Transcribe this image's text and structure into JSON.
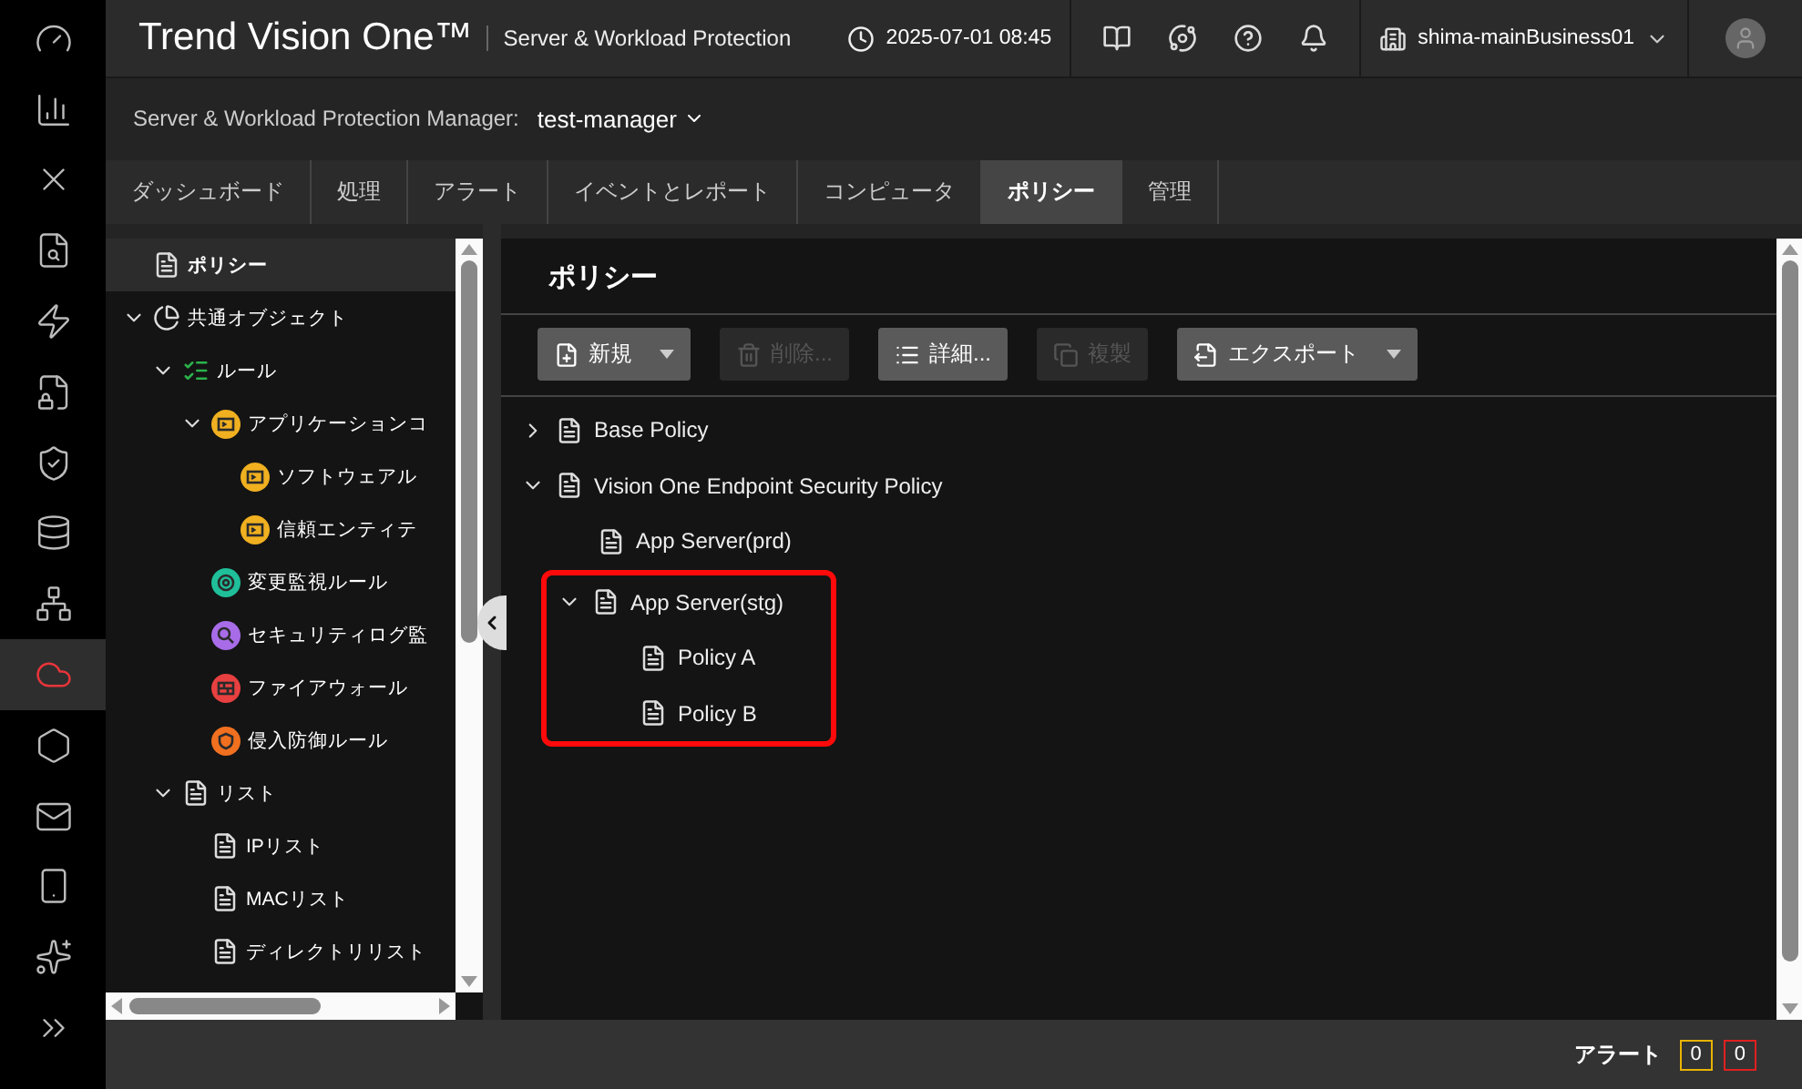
{
  "nav_items": [
    {
      "selected": false
    },
    {
      "selected": false
    },
    {
      "selected": false
    },
    {
      "selected": false
    },
    {
      "selected": false
    },
    {
      "selected": false
    },
    {
      "selected": false
    },
    {
      "selected": false
    },
    {
      "selected": false
    },
    {
      "selected": true
    },
    {
      "selected": false
    },
    {
      "selected": false
    },
    {
      "selected": false
    },
    {
      "selected": false
    },
    {
      "selected": false
    }
  ],
  "header": {
    "brand": "Trend Vision One™",
    "product": "Server & Workload Protection",
    "datetime": "2025-07-01 08:45",
    "account": "shima-mainBusiness01"
  },
  "manager_bar": {
    "label": "Server & Workload Protection Manager:",
    "value": "test-manager"
  },
  "tabs": [
    {
      "label": "ダッシュボード",
      "selected": false
    },
    {
      "label": "処理",
      "selected": false
    },
    {
      "label": "アラート",
      "selected": false
    },
    {
      "label": "イベントとレポート",
      "selected": false
    },
    {
      "label": "コンピュータ",
      "selected": false
    },
    {
      "label": "ポリシー",
      "selected": true
    },
    {
      "label": "管理",
      "selected": false
    }
  ],
  "left_tree": [
    {
      "label": "ポリシー",
      "kind": "policy",
      "selected": true
    },
    {
      "label": "共通オブジェクト",
      "kind": "objects",
      "selected": false,
      "expanded": true,
      "children": [
        {
          "label": "ルール",
          "kind": "rules",
          "selected": false,
          "expanded": true,
          "children": [
            {
              "label": "アプリケーションコ",
              "kind": "app-control",
              "selected": false,
              "expanded": true,
              "children": [
                {
                  "label": "ソフトウェアル",
                  "kind": "app-control",
                  "selected": false
                },
                {
                  "label": "信頼エンティテ",
                  "kind": "app-control",
                  "selected": false
                }
              ]
            },
            {
              "label": "変更監視ルール",
              "kind": "integrity",
              "selected": false
            },
            {
              "label": "セキュリティログ監",
              "kind": "log",
              "selected": false
            },
            {
              "label": "ファイアウォール",
              "kind": "firewall",
              "selected": false
            },
            {
              "label": "侵入防御ルール",
              "kind": "ips",
              "selected": false
            }
          ]
        },
        {
          "label": "リスト",
          "kind": "list",
          "selected": false,
          "expanded": true,
          "children": [
            {
              "label": "IPリスト",
              "kind": "list",
              "selected": false
            },
            {
              "label": "MACリスト",
              "kind": "list",
              "selected": false
            },
            {
              "label": "ディレクトリリスト",
              "kind": "list",
              "selected": false
            }
          ]
        }
      ]
    }
  ],
  "content": {
    "title": "ポリシー",
    "toolbar": [
      {
        "label": "新規",
        "kind": "new",
        "dropdown": true,
        "disabled": false
      },
      {
        "label": "削除...",
        "kind": "delete",
        "dropdown": false,
        "disabled": true
      },
      {
        "label": "詳細...",
        "kind": "details",
        "dropdown": false,
        "disabled": false
      },
      {
        "label": "複製",
        "kind": "copy",
        "dropdown": false,
        "disabled": true
      },
      {
        "label": "エクスポート",
        "kind": "export",
        "dropdown": true,
        "disabled": false
      }
    ],
    "policies": [
      {
        "label": "Base Policy",
        "expanded": false,
        "has_children": true,
        "highlighted": false
      },
      {
        "label": "Vision One Endpoint Security Policy",
        "expanded": true,
        "has_children": true,
        "highlighted": false,
        "children": [
          {
            "label": "App Server(prd)",
            "has_children": false,
            "highlighted": false
          },
          {
            "label": "App Server(stg)",
            "expanded": true,
            "has_children": true,
            "highlighted": true,
            "children": [
              {
                "label": "Policy A",
                "has_children": false,
                "highlighted": false
              },
              {
                "label": "Policy B",
                "has_children": false,
                "highlighted": false
              }
            ]
          }
        ]
      }
    ]
  },
  "status_bar": {
    "label": "アラート",
    "badges": [
      {
        "count": "0",
        "color": "#e8b400"
      },
      {
        "count": "0",
        "color": "#e02020"
      }
    ]
  }
}
